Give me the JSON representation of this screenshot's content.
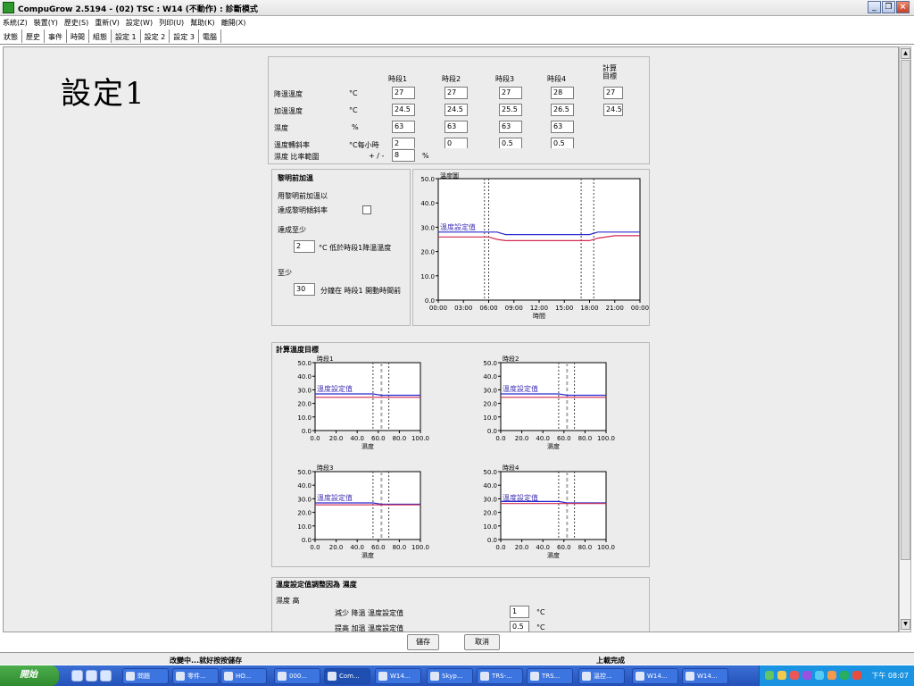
{
  "window": {
    "title": "CompuGrow 2.5194 - (02) TSC : W14 (不動作) : 診斷模式"
  },
  "menu": [
    "系統(Z)",
    "裝置(Y)",
    "歷史(S)",
    "重新(V)",
    "設定(W)",
    "列印(U)",
    "幫助(K)",
    "離開(X)"
  ],
  "tabs": [
    "狀態",
    "歷史",
    "事件",
    "時間",
    "組態",
    "設定 1",
    "設定 2",
    "設定 3",
    "電腦"
  ],
  "active_tab": "設定 1",
  "page_title": "設定1",
  "setpoints": {
    "columns": [
      "時段1",
      "時段2",
      "時段3",
      "時段4",
      "計算\n目標"
    ],
    "rows": [
      {
        "label": "降溫溫度",
        "unit": "°C",
        "values": [
          "27",
          "27",
          "27",
          "28",
          "27"
        ]
      },
      {
        "label": "加溫溫度",
        "unit": "°C",
        "values": [
          "24.5",
          "24.5",
          "25.5",
          "26.5",
          "24.5"
        ]
      },
      {
        "label": "濕度",
        "unit": "%",
        "values": [
          "63",
          "63",
          "63",
          "63"
        ]
      },
      {
        "label": "溫度轉斜率",
        "unit": "°C每小時",
        "values": [
          "2",
          "0",
          "0.5",
          "0.5"
        ]
      }
    ],
    "humidity_range_label": "濕度 比率範圍",
    "humidity_range_sign": "+ / -",
    "humidity_range_value": "8",
    "humidity_range_unit": "%"
  },
  "predawn": {
    "title": "黎明前加溫",
    "line1": "用黎明前加溫以",
    "line2": "達成黎明傾斜率",
    "reach_label": "達成至少",
    "reach_value": "2",
    "reach_suffix": "°C 低於時段1降溫溫度",
    "atleast_label": "至少",
    "atleast_value": "30",
    "atleast_suffix": "分鐘在 時段1 開動時間前"
  },
  "temp_chart": {
    "title": "溫度圖",
    "xlabel": "時間",
    "y_ticks": [
      "50.0",
      "40.0",
      "30.0",
      "20.0",
      "10.0",
      "0.0"
    ],
    "x_ticks": [
      "00:00",
      "03:00",
      "06:00",
      "09:00",
      "12:00",
      "15:00",
      "18:00",
      "21:00",
      "00:00"
    ],
    "overlay_label": "溫度設定值"
  },
  "calc_target": {
    "title": "計算溫度目標",
    "x_label": "濕度",
    "y_ticks": [
      "50.0",
      "40.0",
      "30.0",
      "20.0",
      "10.0",
      "0.0"
    ],
    "x_ticks": [
      "0.0",
      "20.0",
      "40.0",
      "60.0",
      "80.0",
      "100.0"
    ],
    "overlay_label": "溫度設定值",
    "plots": [
      {
        "name": "時段1"
      },
      {
        "name": "時段2"
      },
      {
        "name": "時段3"
      },
      {
        "name": "時段4"
      }
    ]
  },
  "chart_data": [
    {
      "type": "line",
      "title": "溫度圖",
      "xlabel": "時間",
      "ylabel": "",
      "ylim": [
        0,
        50
      ],
      "x": [
        "00:00",
        "03:00",
        "06:00",
        "07:00",
        "08:00",
        "12:00",
        "15:00",
        "18:00",
        "19:00",
        "21:00",
        "00:00"
      ],
      "series": [
        {
          "values": [
            28,
            28,
            28,
            28,
            27,
            27,
            27,
            27,
            28,
            28,
            28
          ]
        },
        {
          "values": [
            26,
            26,
            26,
            25,
            24.5,
            24.5,
            24.5,
            24.5,
            25.5,
            26.5,
            26.5
          ]
        }
      ],
      "grid": false
    },
    {
      "type": "line",
      "title": "時段1",
      "xlabel": "濕度",
      "xlim": [
        0,
        100
      ],
      "ylim": [
        0,
        50
      ],
      "x": [
        0,
        55,
        63,
        100
      ],
      "series": [
        {
          "values": [
            27,
            27,
            26,
            26
          ]
        },
        {
          "values": [
            24.5,
            24.5,
            24.5,
            24.5
          ]
        }
      ]
    },
    {
      "type": "line",
      "title": "時段2",
      "xlabel": "濕度",
      "xlim": [
        0,
        100
      ],
      "ylim": [
        0,
        50
      ],
      "x": [
        0,
        55,
        63,
        100
      ],
      "series": [
        {
          "values": [
            27,
            27,
            26,
            26
          ]
        },
        {
          "values": [
            24.5,
            24.5,
            24.5,
            24.5
          ]
        }
      ]
    },
    {
      "type": "line",
      "title": "時段3",
      "xlabel": "濕度",
      "xlim": [
        0,
        100
      ],
      "ylim": [
        0,
        50
      ],
      "x": [
        0,
        55,
        63,
        100
      ],
      "series": [
        {
          "values": [
            27,
            27,
            26,
            26
          ]
        },
        {
          "values": [
            25.5,
            25.5,
            25.5,
            25.5
          ]
        }
      ]
    },
    {
      "type": "line",
      "title": "時段4",
      "xlabel": "濕度",
      "xlim": [
        0,
        100
      ],
      "ylim": [
        0,
        50
      ],
      "x": [
        0,
        55,
        63,
        100
      ],
      "series": [
        {
          "values": [
            28,
            28,
            27,
            27
          ]
        },
        {
          "values": [
            26.5,
            26.5,
            26.5,
            26.5
          ]
        }
      ]
    }
  ],
  "adjust": {
    "title": "溫度設定值調整因為 濕度",
    "humidity_label": "濕度 高",
    "reduce_label": "減少 降溫 溫度設定值",
    "reduce_value": "1",
    "raise_label": "提高 加溫 溫度設定值",
    "raise_value": "0.5",
    "unit": "°C"
  },
  "buttons": {
    "save": "儲存",
    "cancel": "取消"
  },
  "status": {
    "left": "改變中...就好按按儲存",
    "right": "上載完成"
  },
  "taskbar": {
    "start": "開始",
    "items": [
      "問題",
      "零件...",
      "HO...",
      "000...",
      "Com...",
      "W14...",
      "Skyp...",
      "TRS-...",
      "TRS...",
      "溫控...",
      "W14...",
      "W14..."
    ],
    "active_item": "Com...",
    "clock": "下午 08:07"
  },
  "colors": {
    "cool_line": "#2a2ad0",
    "heat_line": "#d02a50"
  }
}
